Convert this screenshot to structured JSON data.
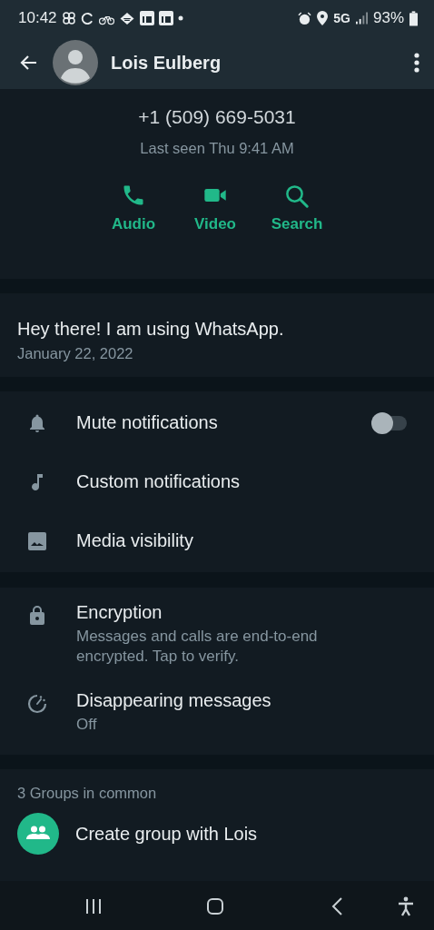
{
  "status_bar": {
    "time": "10:42",
    "network": "5G",
    "battery": "93%"
  },
  "header": {
    "title": "Lois Eulberg"
  },
  "profile": {
    "phone": "+1 (509) 669-5031",
    "last_seen": "Last seen Thu 9:41 AM",
    "actions": [
      {
        "kind": "audio",
        "label": "Audio"
      },
      {
        "kind": "video",
        "label": "Video"
      },
      {
        "kind": "search",
        "label": "Search"
      }
    ]
  },
  "about": {
    "text": "Hey there! I am using WhatsApp.",
    "date": "January 22, 2022"
  },
  "settings": [
    {
      "kind": "mute",
      "label": "Mute notifications",
      "on": false
    },
    {
      "kind": "custom",
      "label": "Custom notifications"
    },
    {
      "kind": "media",
      "label": "Media visibility"
    }
  ],
  "privacy": [
    {
      "kind": "encryption",
      "title": "Encryption",
      "subtitle": "Messages and calls are end-to-end encrypted. Tap to verify."
    },
    {
      "kind": "disappearing",
      "title": "Disappearing messages",
      "subtitle": "Off"
    }
  ],
  "groups": {
    "heading": "3 Groups in common",
    "create_label": "Create group with Lois"
  }
}
